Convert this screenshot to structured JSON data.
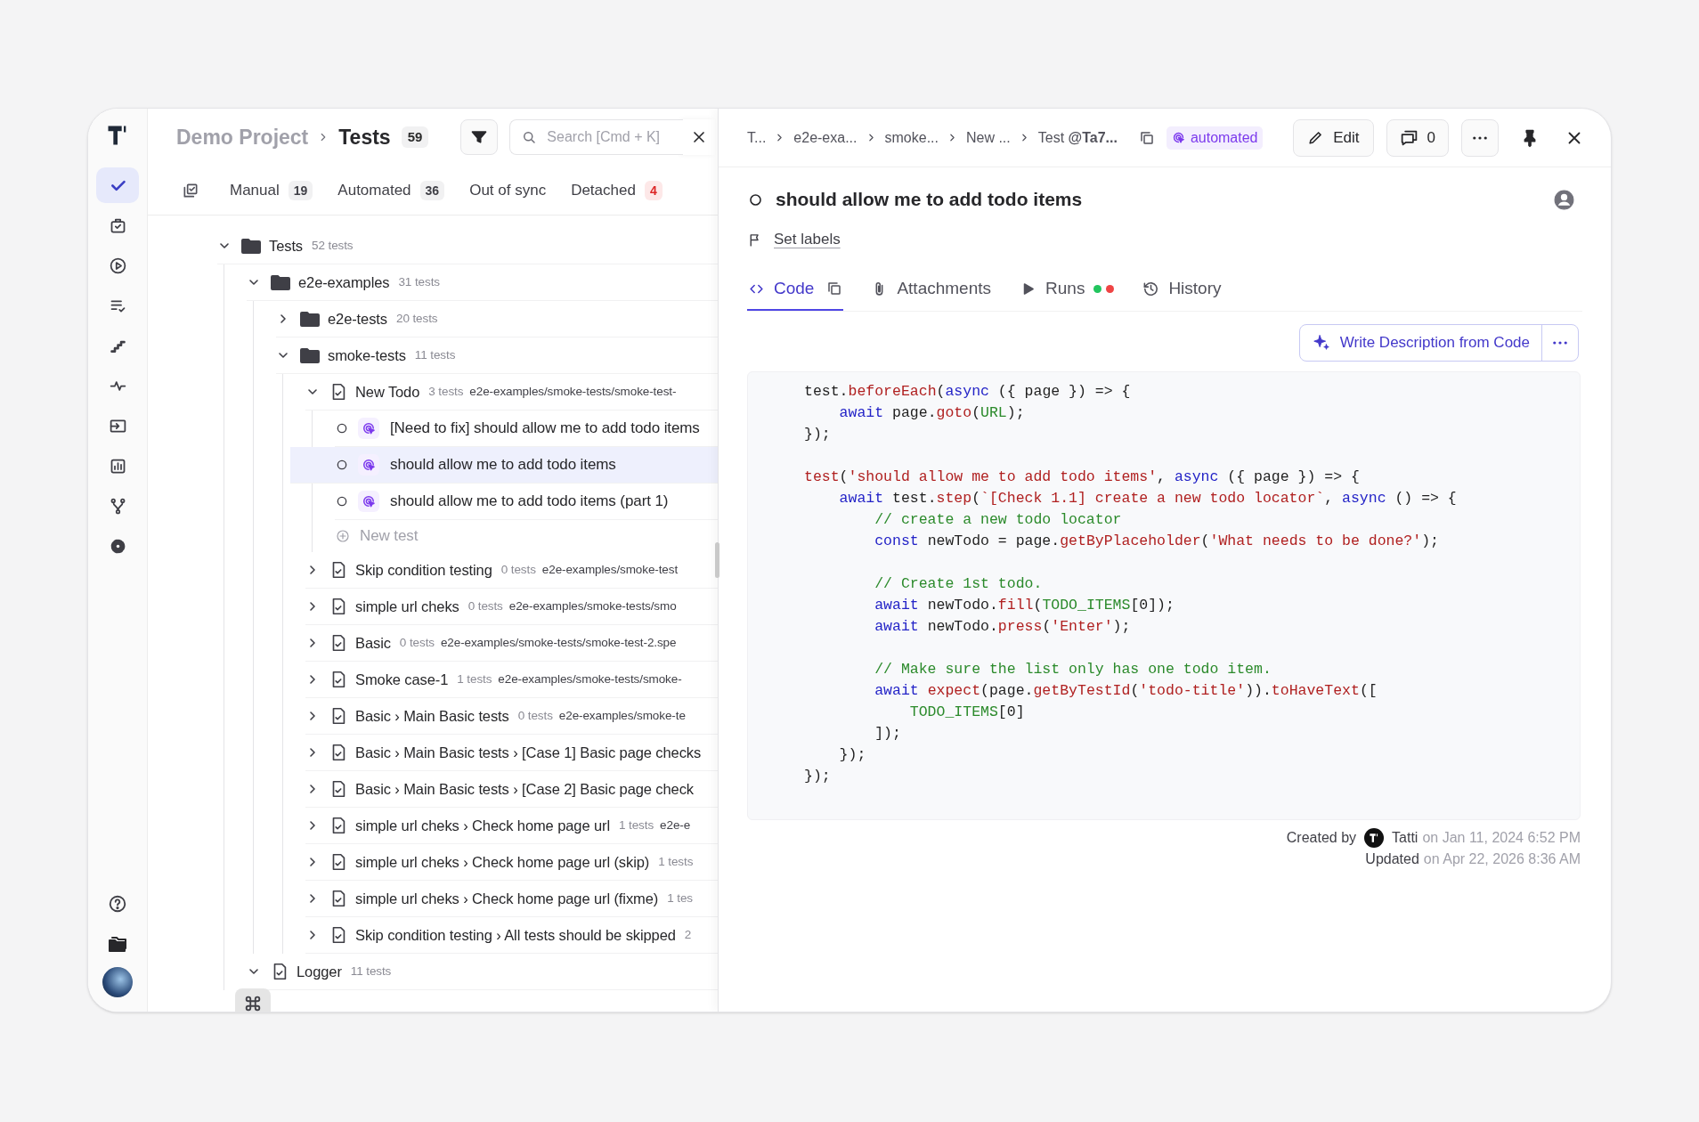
{
  "rail": {
    "items": [
      {
        "selected": true
      },
      {
        "selected": false
      },
      {
        "selected": false
      },
      {
        "selected": false
      },
      {
        "selected": false
      },
      {
        "selected": false
      },
      {
        "selected": false
      },
      {
        "selected": false
      },
      {
        "selected": false
      },
      {
        "selected": false
      }
    ]
  },
  "header": {
    "project": "Demo Project",
    "section": "Tests",
    "count": "59",
    "search": {
      "placeholder": "Search [Cmd + K]"
    }
  },
  "filter_tabs": [
    {
      "label": "Manual",
      "count": "19",
      "warning": false
    },
    {
      "label": "Automated",
      "count": "36",
      "warning": false
    },
    {
      "label": "Out of sync"
    },
    {
      "label": "Detached",
      "count": "4",
      "warning": true
    }
  ],
  "tree": [
    {
      "kind": "folder",
      "label": "Tests",
      "count": "52 tests",
      "expanded": true,
      "children": [
        {
          "kind": "folder",
          "label": "e2e-examples",
          "count": "31 tests",
          "expanded": true,
          "children": [
            {
              "kind": "folder",
              "label": "e2e-tests",
              "count": "20 tests",
              "expanded": false
            },
            {
              "kind": "folder",
              "label": "smoke-tests",
              "count": "11 tests",
              "expanded": true,
              "children": [
                {
                  "kind": "suite",
                  "label": "New Todo",
                  "count": "3 tests",
                  "path": "e2e-examples/smoke-tests/smoke-test-",
                  "expanded": true,
                  "children": [
                    {
                      "kind": "test",
                      "label": "[Need to fix] should allow me to add todo items",
                      "selected": false
                    },
                    {
                      "kind": "test",
                      "label": "should allow me to add todo items",
                      "selected": true
                    },
                    {
                      "kind": "test",
                      "label": "should allow me to add todo items (part 1)",
                      "selected": false
                    },
                    {
                      "kind": "new",
                      "label": "New test"
                    }
                  ]
                },
                {
                  "kind": "suite",
                  "label": "Skip condition testing",
                  "count": "0 tests",
                  "path": "e2e-examples/smoke-test",
                  "expanded": false
                },
                {
                  "kind": "suite",
                  "label": "simple url cheks",
                  "count": "0 tests",
                  "path": "e2e-examples/smoke-tests/smo",
                  "expanded": false
                },
                {
                  "kind": "suite",
                  "label": "Basic",
                  "count": "0 tests",
                  "path": "e2e-examples/smoke-tests/smoke-test-2.spe",
                  "expanded": false
                },
                {
                  "kind": "suite",
                  "label": "Smoke case-1",
                  "count": "1 tests",
                  "path": "e2e-examples/smoke-tests/smoke-",
                  "expanded": false
                },
                {
                  "kind": "suite",
                  "label": "Basic › Main Basic tests",
                  "count": "0 tests",
                  "path": "e2e-examples/smoke-te",
                  "expanded": false
                },
                {
                  "kind": "suite",
                  "label": "Basic › Main Basic tests › [Case 1] Basic page checks",
                  "expanded": false
                },
                {
                  "kind": "suite",
                  "label": "Basic › Main Basic tests › [Case 2] Basic page check",
                  "expanded": false
                },
                {
                  "kind": "suite",
                  "label": "simple url cheks › Check home page url",
                  "count": "1 tests",
                  "path": "e2e-e",
                  "expanded": false
                },
                {
                  "kind": "suite",
                  "label": "simple url cheks › Check home page url (skip)",
                  "count": "1 tests",
                  "expanded": false
                },
                {
                  "kind": "suite",
                  "label": "simple url cheks › Check home page url (fixme)",
                  "count": "1 tes",
                  "expanded": false
                },
                {
                  "kind": "suite",
                  "label": "Skip condition testing › All tests should be skipped",
                  "count": "2",
                  "expanded": false
                }
              ]
            }
          ]
        },
        {
          "kind": "suite",
          "label": "Logger",
          "count": "11 tests",
          "expanded": true
        }
      ]
    }
  ],
  "detail": {
    "breadcrumbs": [
      "T...",
      "e2e-exa...",
      "smoke...",
      "New ...",
      "Test **@Ta7...**"
    ],
    "badge": "automated",
    "edit_button": "Edit",
    "comments": "0",
    "title": "should allow me to add todo items",
    "set_labels": "Set labels",
    "tabs": [
      {
        "label": "Code",
        "selected": true
      },
      {
        "label": "Attachments",
        "selected": false
      },
      {
        "label": "Runs",
        "selected": false,
        "status_dots": [
          {
            "color": "#22c55e"
          },
          {
            "color": "#ef4444"
          }
        ]
      },
      {
        "label": "History",
        "selected": false
      }
    ],
    "write_button": "Write Description from Code",
    "code": {
      "blocks": [
        [
          [
            {
              "kind": "plain",
              "text": "test."
            },
            {
              "kind": "method",
              "text": "beforeEach"
            },
            {
              "kind": "plain",
              "text": "("
            },
            {
              "kind": "keyword",
              "text": "async"
            },
            {
              "kind": "plain",
              "text": " ({ page }) => {"
            }
          ],
          [
            {
              "kind": "keyword",
              "text": "    await"
            },
            {
              "kind": "plain",
              "text": " page."
            },
            {
              "kind": "method",
              "text": "goto"
            },
            {
              "kind": "plain",
              "text": "("
            },
            {
              "kind": "constant",
              "text": "URL"
            },
            {
              "kind": "plain",
              "text": ");"
            }
          ],
          [
            {
              "kind": "plain",
              "text": "});"
            }
          ]
        ],
        [
          [
            {
              "kind": "method",
              "text": "test"
            },
            {
              "kind": "plain",
              "text": "("
            },
            {
              "kind": "string",
              "text": "'should allow me to add todo items'"
            },
            {
              "kind": "plain",
              "text": ", "
            },
            {
              "kind": "keyword",
              "text": "async"
            },
            {
              "kind": "plain",
              "text": " ({ page }) => {"
            }
          ],
          [
            {
              "kind": "keyword",
              "text": "    await"
            },
            {
              "kind": "plain",
              "text": " test."
            },
            {
              "kind": "method",
              "text": "step"
            },
            {
              "kind": "plain",
              "text": "("
            },
            {
              "kind": "string",
              "text": "`[Check 1.1] create a new todo locator`"
            },
            {
              "kind": "plain",
              "text": ", "
            },
            {
              "kind": "keyword",
              "text": "async"
            },
            {
              "kind": "plain",
              "text": " () => {"
            }
          ],
          [
            {
              "kind": "comment",
              "text": "        // create a new todo locator"
            }
          ],
          [
            {
              "kind": "keyword",
              "text": "        const"
            },
            {
              "kind": "plain",
              "text": " newTodo = page."
            },
            {
              "kind": "method",
              "text": "getByPlaceholder"
            },
            {
              "kind": "plain",
              "text": "("
            },
            {
              "kind": "string",
              "text": "'What needs to be done?'"
            },
            {
              "kind": "plain",
              "text": ");"
            }
          ]
        ],
        [
          [
            {
              "kind": "comment",
              "text": "        // Create 1st todo."
            }
          ],
          [
            {
              "kind": "keyword",
              "text": "        await"
            },
            {
              "kind": "plain",
              "text": " newTodo."
            },
            {
              "kind": "method",
              "text": "fill"
            },
            {
              "kind": "plain",
              "text": "("
            },
            {
              "kind": "constant",
              "text": "TODO_ITEMS"
            },
            {
              "kind": "plain",
              "text": "[0]);"
            }
          ],
          [
            {
              "kind": "keyword",
              "text": "        await"
            },
            {
              "kind": "plain",
              "text": " newTodo."
            },
            {
              "kind": "method",
              "text": "press"
            },
            {
              "kind": "plain",
              "text": "("
            },
            {
              "kind": "string",
              "text": "'Enter'"
            },
            {
              "kind": "plain",
              "text": ");"
            }
          ]
        ],
        [
          [
            {
              "kind": "comment",
              "text": "        // Make sure the list only has one todo item."
            }
          ],
          [
            {
              "kind": "keyword",
              "text": "        await "
            },
            {
              "kind": "method",
              "text": "expect"
            },
            {
              "kind": "plain",
              "text": "(page."
            },
            {
              "kind": "method",
              "text": "getByTestId"
            },
            {
              "kind": "plain",
              "text": "("
            },
            {
              "kind": "string",
              "text": "'todo-title'"
            },
            {
              "kind": "plain",
              "text": "))."
            },
            {
              "kind": "method",
              "text": "toHaveText"
            },
            {
              "kind": "plain",
              "text": "(["
            }
          ],
          [
            {
              "kind": "constant",
              "text": "            TODO_ITEMS"
            },
            {
              "kind": "plain",
              "text": "[0]"
            }
          ],
          [
            {
              "kind": "plain",
              "text": "        ]);"
            }
          ],
          [
            {
              "kind": "plain",
              "text": "    });"
            }
          ],
          [
            {
              "kind": "plain",
              "text": "});"
            }
          ]
        ]
      ]
    },
    "footer": {
      "created_label": "Created by",
      "author": "Tatti",
      "created_on": "on Jan 11, 2024 6:52 PM",
      "updated_label": "Updated",
      "updated_on": "on Apr 22, 2026 8:36 AM"
    }
  }
}
